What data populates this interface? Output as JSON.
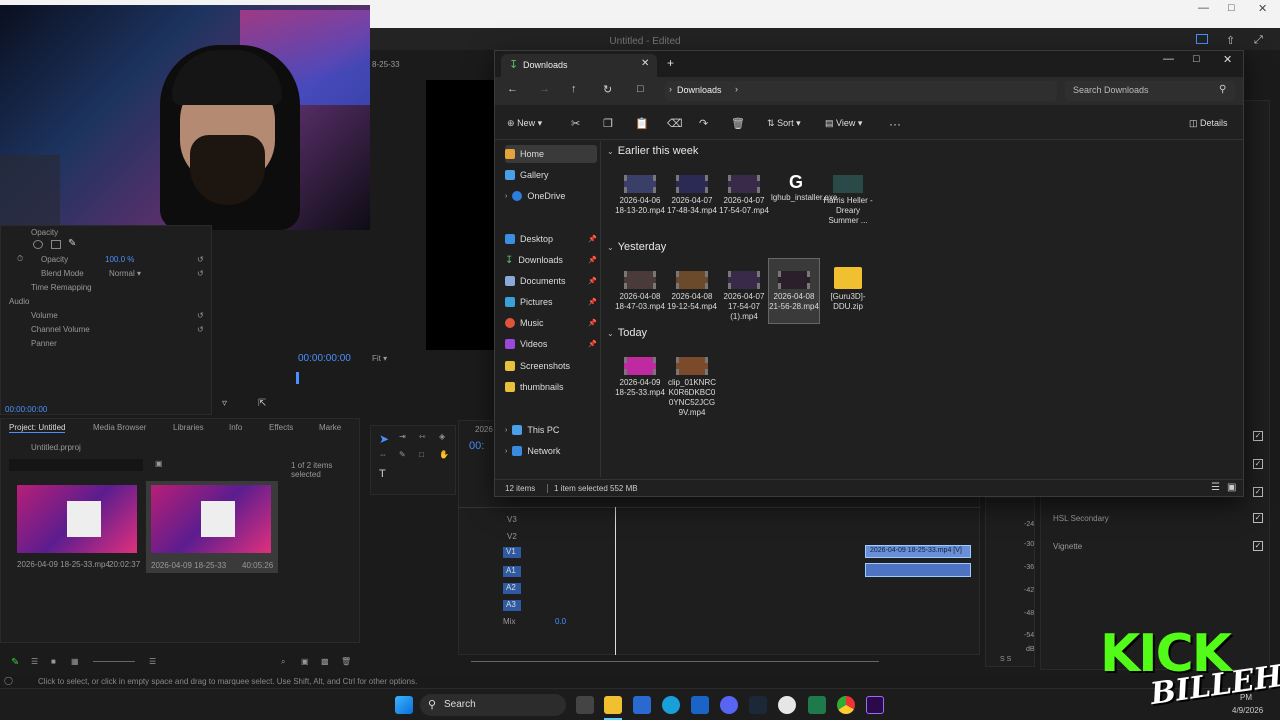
{
  "premiere": {
    "title": "Untitled - Edited",
    "timecode_header": "8-25-33",
    "effect_controls": {
      "opacity_section": "Opacity",
      "opacity_label": "Opacity",
      "opacity_value": "100.0 %",
      "blend_mode_label": "Blend Mode",
      "blend_mode_value": "Normal",
      "time_remapping": "Time Remapping",
      "audio_label": "Audio",
      "volume": "Volume",
      "channel_volume": "Channel Volume",
      "panner": "Panner",
      "timecode": "00:00:00:00"
    },
    "program": {
      "timecode": "00:00:00:00",
      "fit": "Fit"
    },
    "project": {
      "tabs": [
        "Project: Untitled",
        "Media Browser",
        "Libraries",
        "Info",
        "Effects",
        "Marke"
      ],
      "file_name": "Untitled.prproj",
      "selection_info": "1 of 2 items selected",
      "clips": [
        {
          "name": "2026-04-09 18-25-33.mp4",
          "duration": "20:02:37"
        },
        {
          "name": "2026-04-09 18-25-33",
          "duration": "40:05:26"
        }
      ]
    },
    "timeline": {
      "tab": "2026",
      "timecode": "00:",
      "tracks": [
        "V3",
        "V2",
        "V1",
        "A1",
        "A2",
        "A3"
      ],
      "mix_label": "Mix",
      "mix_value": "0.0",
      "clip_label": "2026-04-09 18-25-33.mp4 [V]"
    },
    "lumetri": {
      "items": [
        "HSL Secondary",
        "Vignette"
      ],
      "meter_ticks": [
        "-24",
        "-30",
        "-36",
        "-42",
        "-48",
        "-54",
        "dB"
      ],
      "meter_footer": "S S"
    },
    "status_text": "Click to select, or click in empty space and drag to marquee select. Use Shift, Alt, and Ctrl for other options."
  },
  "explorer": {
    "tab_title": "Downloads",
    "address": "Downloads",
    "search_placeholder": "Search Downloads",
    "commands": {
      "new": "New",
      "sort": "Sort",
      "view": "View",
      "more": "···",
      "details": "Details"
    },
    "sidebar": {
      "top": [
        "Home",
        "Gallery",
        "OneDrive"
      ],
      "pinned": [
        "Desktop",
        "Downloads",
        "Documents",
        "Pictures",
        "Music",
        "Videos",
        "Screenshots",
        "thumbnails"
      ],
      "bottom": [
        "This PC",
        "Network"
      ]
    },
    "groups": [
      {
        "title": "Earlier this week",
        "files": [
          "2026-04-06 18-13-20.mp4",
          "2026-04-07 17-48-34.mp4",
          "2026-04-07 17-54-07.mp4",
          "lghub_installer.exe",
          "Harris Heller - Dreary Summer ..."
        ]
      },
      {
        "title": "Yesterday",
        "files": [
          "2026-04-08 18-47-03.mp4",
          "2026-04-08 19-12-54.mp4",
          "2026-04-07 17-54-07 (1).mp4",
          "2026-04-08 21-56-28.mp4",
          "[Guru3D]-DDU.zip"
        ]
      },
      {
        "title": "Today",
        "files": [
          "2026-04-09 18-25-33.mp4",
          "clip_01KNRCK0R6DKBC00YNC52JCG9V.mp4"
        ]
      }
    ],
    "status": {
      "count": "12 items",
      "selected": "1 item selected  552 MB"
    }
  },
  "taskbar": {
    "search": "Search",
    "time": "PM",
    "date": "4/9/2026"
  },
  "overlay": {
    "kick": "KICK",
    "name": "BILLEH"
  }
}
